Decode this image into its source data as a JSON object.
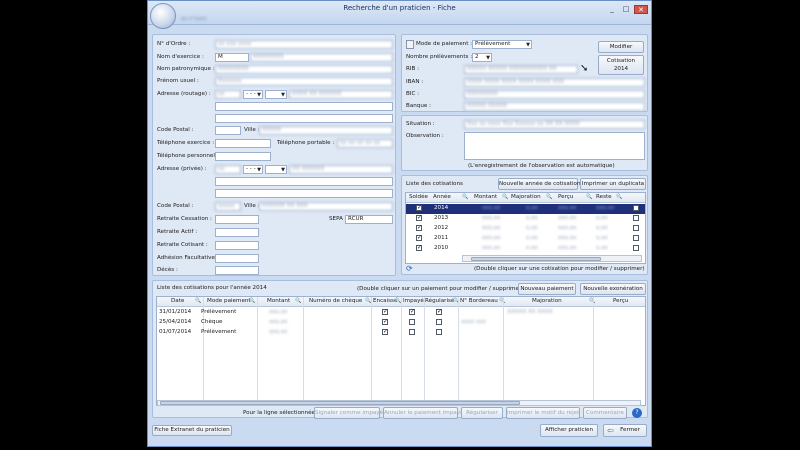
{
  "window": {
    "title": "Recherche d'un praticien - Fiche",
    "subtitle": "au n°xxxx",
    "controls": [
      "_",
      "□",
      "✕"
    ]
  },
  "identity": {
    "ordre_label": "N° d'Ordre :",
    "ordre_value": "xx xxx xxxx",
    "nom_exercice_label": "Nom d'exercice :",
    "nom_exercice_value": "M",
    "nom_exercice_extra": "XXXXXXXX",
    "nom_patro_label": "Nom patronymique :",
    "nom_patro_value": "XXXXXXXX",
    "prenom_label": "Prénom usuel :",
    "prenom_value": "Xxxxxxx",
    "adresse_routage_label": "Adresse (routage) :",
    "adresse_routage_num": "xx",
    "adresse_routage_voie": "XXXX XX XXXXXX",
    "dash": "- - -",
    "code_postal_label": "Code Postal :",
    "code_postal_value": "",
    "ville_label": "Ville :",
    "ville_value": "XXXXX",
    "tel_exercice_label": "Téléphone exercice :",
    "tel_exercice_value": "",
    "tel_portable_label": "Téléphone portable :",
    "tel_portable_value": "xx xx xx xx xx",
    "tel_personnel_label": "Téléphone personnel :",
    "tel_personnel_value": "",
    "adresse_privee_label": "Adresse (privée) :",
    "adresse_privee_num": "xx",
    "adresse_privee_voie": "XX XXXXXX",
    "code_postal2_label": "Code Postal :",
    "code_postal2_value": "xxxxx",
    "ville2_label": "Ville :",
    "ville2_value": "XXXXXX XX XXX",
    "retraite_cessation_label": "Retraite Cessation :",
    "sepa_label": "SEPA :",
    "sepa_value": "RCUR",
    "retraite_actif_label": "Retraite Actif :",
    "retraite_cotisant_label": "Retraite Cotisant :",
    "adhesion_label": "Adhésion Facultative :",
    "deces_label": "Décès :"
  },
  "payment": {
    "mode_label": "Mode de paiement :",
    "mode_value": "Prélèvement",
    "nb_prelev_label": "Nombre prélèvements :",
    "nb_prelev_value": "2",
    "rib_label": "RIB :",
    "rib_value": "XXXXX XXXXX XXXXXXXXXX XX",
    "iban_label": "IBAN :",
    "iban_value": "XXXX XXXX XXXX XXXX XXXX XXX",
    "bic_label": "BIC :",
    "bic_value": "XXXXXXXX",
    "banque_label": "Banque :",
    "banque_value": "XXXXX XXXXX",
    "modifier_label": "Modifier",
    "cotisation_btn": "Cotisation 2014"
  },
  "situation": {
    "situation_label": "Situation :",
    "situation_value": "Xxx xx xxxx Xxx Xxxxxx xx XX XX XXXX",
    "observation_label": "Observation :",
    "note": "(L'enregistrement de l'observation est automatique)"
  },
  "cotisations": {
    "title": "Liste des cotisations",
    "nouvelle_btn": "Nouvelle année de cotisation",
    "duplicata_btn": "Imprimer un duplicata",
    "headers": [
      "Soldée",
      "Année",
      "Montant",
      "Majoration",
      "Perçu",
      "Reste"
    ],
    "rows": [
      {
        "year": "2014",
        "montant": "xxx,xx",
        "majoration": "x,xx",
        "percu": "xxx,xx",
        "reste": "xxx,xx",
        "selected": true
      },
      {
        "year": "2013",
        "montant": "xxx,xx",
        "majoration": "x,xx",
        "percu": "xxx,xx",
        "reste": "x,xx",
        "selected": false
      },
      {
        "year": "2012",
        "montant": "xxx,xx",
        "majoration": "x,xx",
        "percu": "xxx,xx",
        "reste": "x,xx",
        "selected": false
      },
      {
        "year": "2011",
        "montant": "xxx,xx",
        "majoration": "x,xx",
        "percu": "xxx,xx",
        "reste": "x,xx",
        "selected": false
      },
      {
        "year": "2010",
        "montant": "xxx,xx",
        "majoration": "x,xx",
        "percu": "xxx,xx",
        "reste": "x,xx",
        "selected": false
      }
    ],
    "hint": "(Double cliquer sur une cotisation pour modifier / supprimer)"
  },
  "paiements": {
    "title": "Liste des cotisations pour l'année 2014",
    "hint": "(Double cliquer sur un paiement pour modifier / supprimer)",
    "nouveau_btn": "Nouveau paiement",
    "exoneration_btn": "Nouvelle exonération",
    "headers": [
      "Date",
      "Mode paiement",
      "Montant",
      "Numéro de chèque",
      "Encaissé",
      "Impayé",
      "Régularisé",
      "N° Bordereau",
      "Majoration",
      "Perçu"
    ],
    "rows": [
      {
        "date": "31/01/2014",
        "mode": "Prélèvement",
        "montant": "xxx,xx",
        "majoration": "XXXXX XX XXXX",
        "encaisse": true,
        "impaye": true,
        "regul": true,
        "bordereau": ""
      },
      {
        "date": "25/04/2014",
        "mode": "Chèque",
        "montant": "xxx,xx",
        "majoration": "",
        "encaisse": true,
        "impaye": false,
        "regul": false,
        "bordereau": "xxxx xxx"
      },
      {
        "date": "01/07/2014",
        "mode": "Prélèvement",
        "montant": "xxx,xx",
        "majoration": "",
        "encaisse": true,
        "impaye": false,
        "regul": false,
        "bordereau": ""
      }
    ]
  },
  "footer_actions": {
    "label": "Pour la ligne sélectionnée :",
    "impaye_btn": "Signaler comme impayé",
    "annuler_btn": "Annuler le paiement impayé",
    "regulariser_btn": "Régulariser",
    "motif_btn": "Imprimer le motif du rejet",
    "commentaire_btn": "Commentaire"
  },
  "bottom": {
    "extranet_btn": "Fiche Extranet du praticien",
    "afficher_btn": "Afficher praticien",
    "fermer_btn": "Fermer"
  }
}
